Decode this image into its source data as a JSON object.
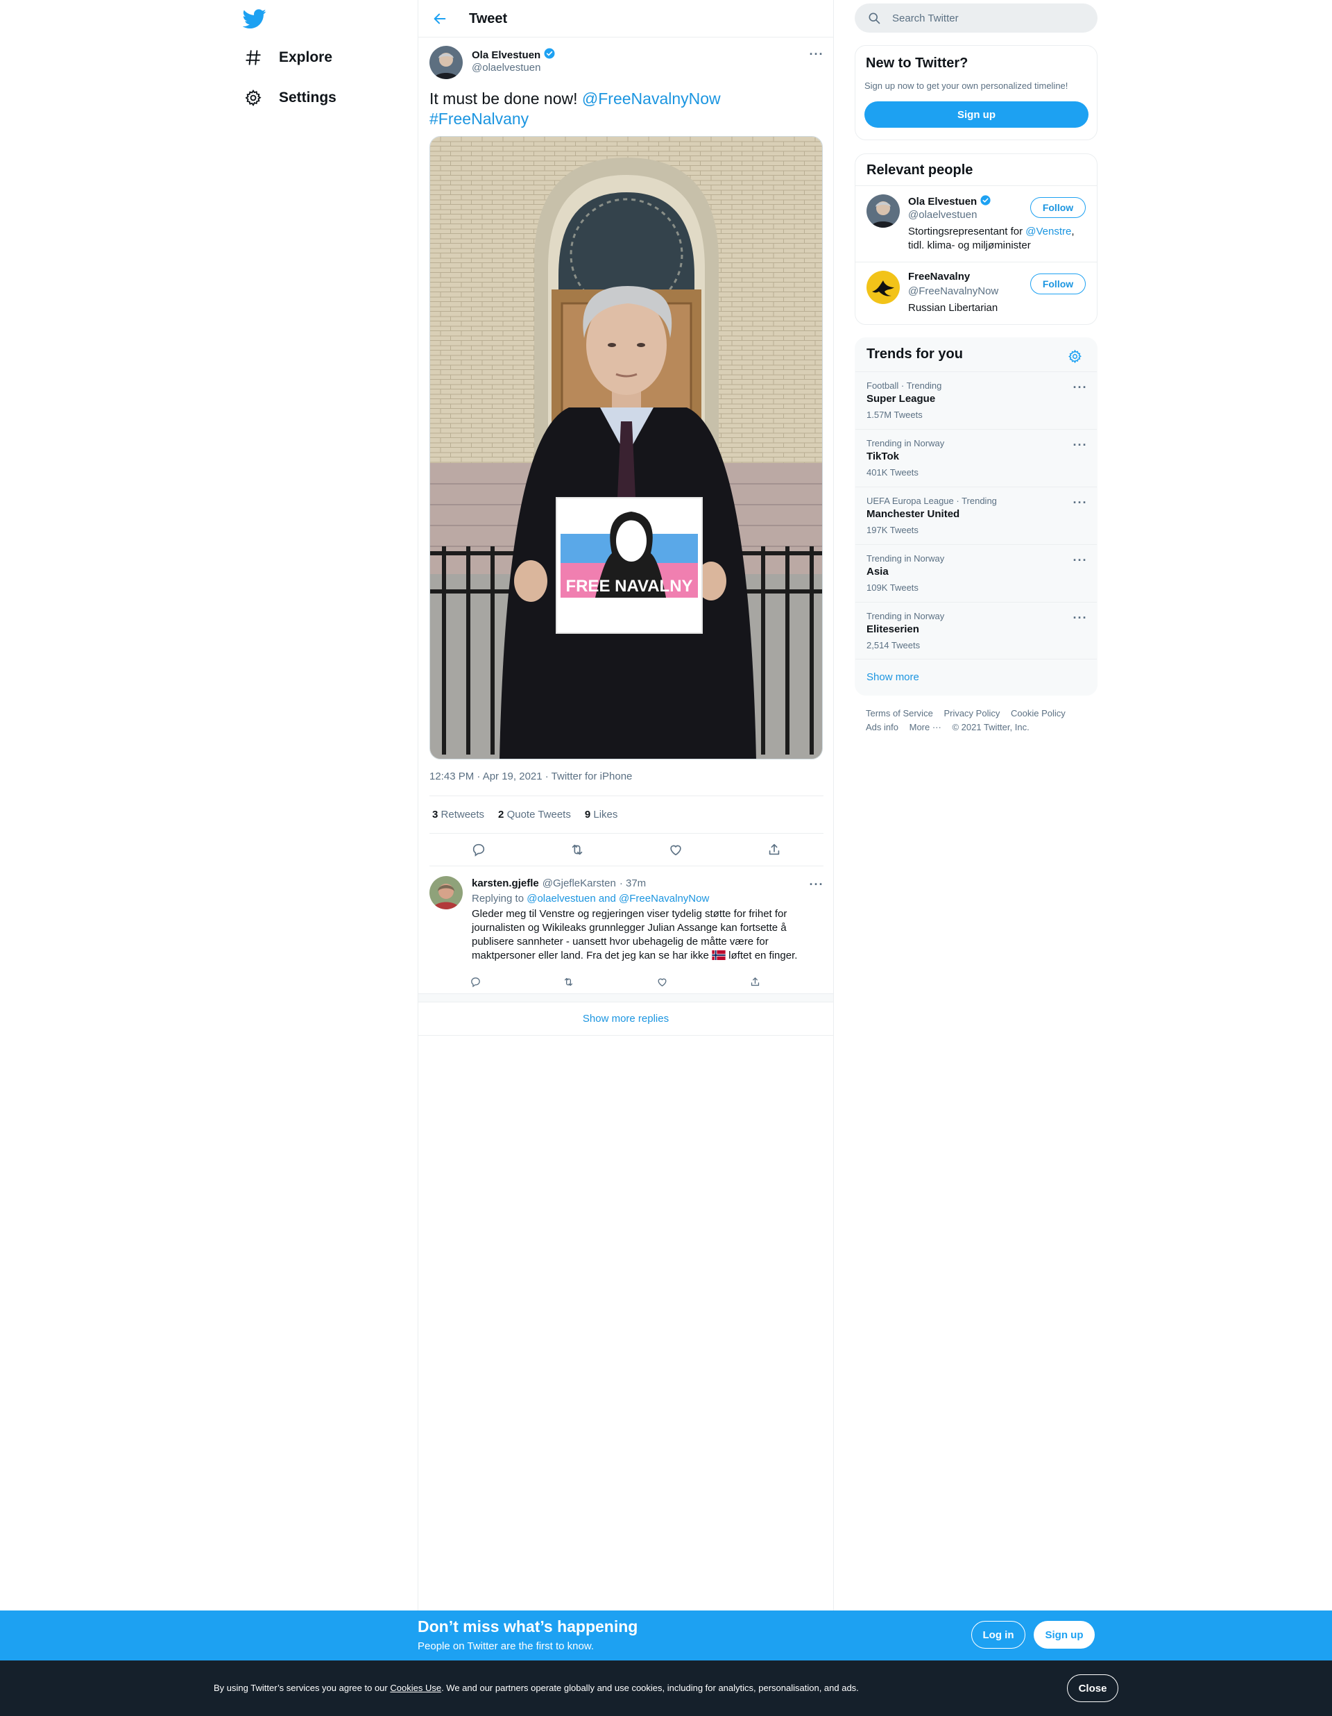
{
  "nav": {
    "items": [
      {
        "label": "Explore",
        "icon": "hashtag-icon"
      },
      {
        "label": "Settings",
        "icon": "gear-icon"
      }
    ]
  },
  "header": {
    "title": "Tweet"
  },
  "tweet": {
    "author_name": "Ola Elvestuen",
    "author_handle": "@olaelvestuen",
    "text_plain": "It must be done now! ",
    "mention": "@FreeNavalnyNow",
    "hashtag": "#FreeNalvany",
    "photo_sign_text": "FREE NAVALNY",
    "meta": "12:43 PM · Apr 19, 2021 · Twitter for iPhone",
    "stats": {
      "retweets_count": "3",
      "retweets_label": "Retweets",
      "quotes_count": "2",
      "quotes_label": "Quote Tweets",
      "likes_count": "9",
      "likes_label": "Likes"
    }
  },
  "reply": {
    "name": "karsten.gjefle",
    "handle": "@GjefleKarsten",
    "time": "· 37m",
    "replying_prefix": "Replying to ",
    "replying_to": "@olaelvestuen and @FreeNavalnyNow",
    "text_before_flag": "Gleder meg til Venstre og regjeringen viser tydelig støtte for frihet for journalisten og Wikileaks grunnlegger Julian Assange kan fortsette å publisere sannheter - uansett hvor ubehagelig de måtte være for maktpersoner eller land. Fra det jeg kan se har ikke ",
    "text_after_flag": " løftet en finger."
  },
  "show_more_replies": "Show more replies",
  "search": {
    "placeholder": "Search Twitter"
  },
  "new_to_twitter": {
    "title": "New to Twitter?",
    "subtitle": "Sign up now to get your own personalized timeline!",
    "button": "Sign up"
  },
  "relevant_people": {
    "title": "Relevant people",
    "people": [
      {
        "name": "Ola Elvestuen",
        "handle": "@olaelvestuen",
        "bio_before": "Stortingsrepresentant for ",
        "bio_link": "@Venstre",
        "bio_after": ", tidl. klima- og miljøminister",
        "button": "Follow"
      },
      {
        "name": "FreeNavalny",
        "handle": "@FreeNavalnyNow",
        "bio_before": "Russian Libertarian",
        "bio_link": "",
        "bio_after": "",
        "button": "Follow"
      }
    ]
  },
  "trends": {
    "title": "Trends for you",
    "items": [
      {
        "context": "Football · Trending",
        "name": "Super League",
        "count": "1.57M Tweets"
      },
      {
        "context": "Trending in Norway",
        "name": "TikTok",
        "count": "401K Tweets"
      },
      {
        "context": "UEFA Europa League · Trending",
        "name": "Manchester United",
        "count": "197K Tweets"
      },
      {
        "context": "Trending in Norway",
        "name": "Asia",
        "count": "109K Tweets"
      },
      {
        "context": "Trending in Norway",
        "name": "Eliteserien",
        "count": "2,514 Tweets"
      }
    ],
    "show_more": "Show more"
  },
  "footer": {
    "links": [
      "Terms of Service",
      "Privacy Policy",
      "Cookie Policy",
      "Ads info",
      "More ···",
      "© 2021 Twitter, Inc."
    ]
  },
  "bottom_bar": {
    "title": "Don’t miss what’s happening",
    "subtitle": "People on Twitter are the first to know.",
    "login": "Log in",
    "signup": "Sign up"
  },
  "cookie": {
    "text_before": "By using Twitter’s services you agree to our ",
    "link": "Cookies Use",
    "text_after": ". We and our partners operate globally and use cookies, including for analytics, personalisation, and ads.",
    "close": "Close"
  },
  "colors": {
    "accent": "#1da1f2",
    "link": "#1b95e0",
    "text": "#0f1419",
    "secondary": "#5b7083",
    "cookie_bg": "#15202b"
  }
}
